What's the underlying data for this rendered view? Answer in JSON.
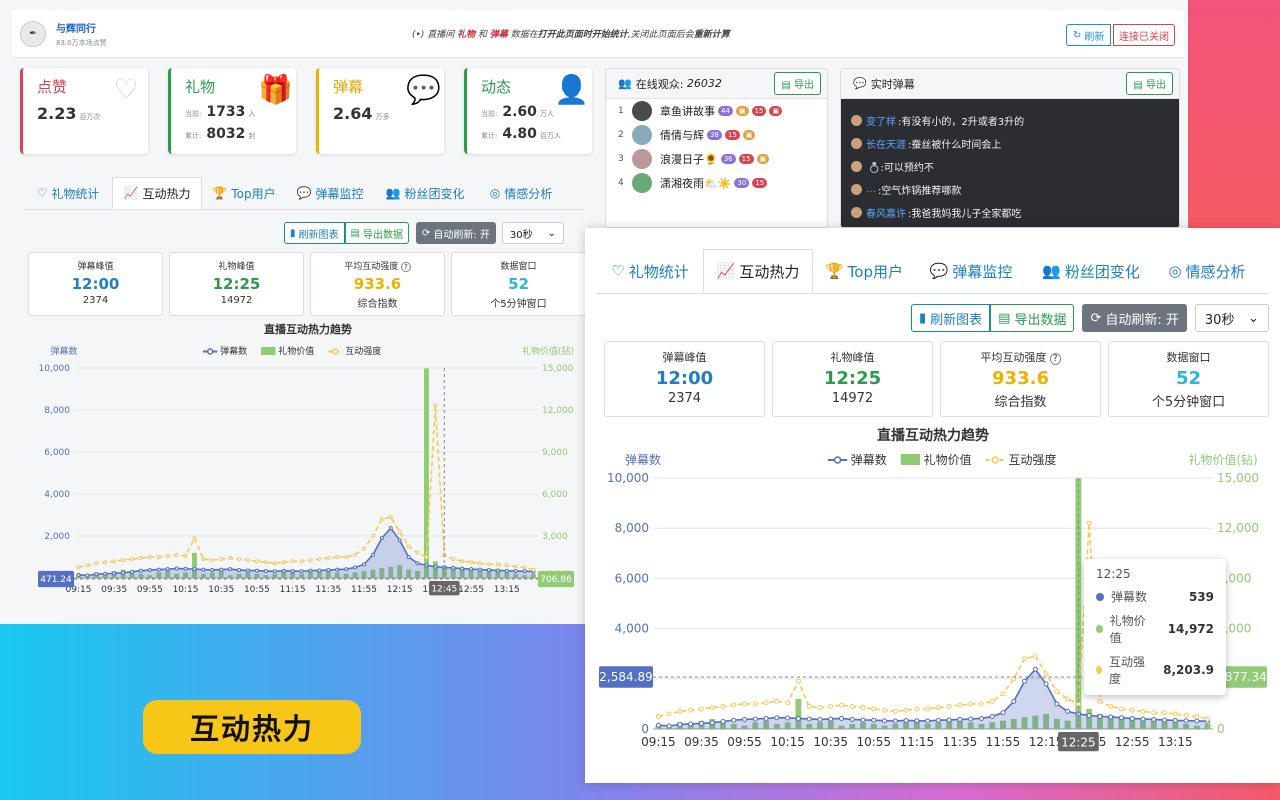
{
  "header": {
    "streamer_name": "与辉同行",
    "streamer_sub": "83.0万本场点赞",
    "notice_prefix": "直播间",
    "notice_gift": "礼物",
    "notice_and": "和",
    "notice_danmu": "弹幕",
    "notice_middle": "数据在",
    "notice_open": "打开此页面时开始统计",
    "notice_close": ",关闭此页面后会",
    "notice_recalc": "重新计算",
    "refresh_label": "刷新",
    "closed_label": "连接已关闭"
  },
  "stats": {
    "likes": {
      "title": "点赞",
      "value": "2.23",
      "unit": "百万次",
      "color": "#d9434f"
    },
    "gifts": {
      "title": "礼物",
      "current_label": "当前:",
      "current_value": "1733",
      "current_unit": "人",
      "total_label": "累计:",
      "total_value": "8032",
      "total_unit": "封",
      "color": "#2d9a4d"
    },
    "danmu": {
      "title": "弹幕",
      "value": "2.64",
      "unit": "万多",
      "color": "#e0a800"
    },
    "activity": {
      "title": "动态",
      "current_label": "当前:",
      "current_value": "2.60",
      "current_unit": "万人",
      "total_label": "累计:",
      "total_value": "4.80",
      "total_unit": "百万人",
      "color": "#2d9a4d"
    }
  },
  "viewers": {
    "title": "在线观众:",
    "count": "26032",
    "export_label": "导出",
    "items": [
      {
        "rank": "1",
        "name": "章鱼讲故事",
        "level": "44"
      },
      {
        "rank": "2",
        "name": "倩倩与辉",
        "level": "38"
      },
      {
        "rank": "3",
        "name": "浪漫日子🌻",
        "level": "36"
      },
      {
        "rank": "4",
        "name": "潇湘夜雨⛅☀️",
        "level": "30"
      }
    ]
  },
  "live_danmu": {
    "title": "实时弹幕",
    "export_label": "导出",
    "items": [
      {
        "user": "变了样",
        "text": ":有没有小的，2升或者3升的"
      },
      {
        "user": "长在天涯",
        "text": ":蚕丝被什么时间会上"
      },
      {
        "user": "",
        "text": "💍:可以预约不"
      },
      {
        "user": "…",
        "text": ":空气炸锅推荐哪款"
      },
      {
        "user": "春风嘉许",
        "text": ":我爸我妈我儿子全家都吃"
      }
    ]
  },
  "tabs": [
    {
      "label": "礼物统计",
      "icon": "heart-icon",
      "glyph": "♡"
    },
    {
      "label": "互动热力",
      "icon": "line-chart-icon",
      "glyph": "📈"
    },
    {
      "label": "Top用户",
      "icon": "trophy-icon",
      "glyph": "🏆"
    },
    {
      "label": "弹幕监控",
      "icon": "chat-icon",
      "glyph": "💬"
    },
    {
      "label": "粉丝团变化",
      "icon": "people-icon",
      "glyph": "👥"
    },
    {
      "label": "情感分析",
      "icon": "target-icon",
      "glyph": "◎"
    }
  ],
  "controls": {
    "refresh_chart": "刷新图表",
    "export_data": "导出数据",
    "auto_refresh": "自动刷新: 开",
    "interval": "30秒"
  },
  "kpis": [
    {
      "label": "弹幕峰值",
      "value": "12:00",
      "sub": "2374",
      "color": "#1d7fc7"
    },
    {
      "label": "礼物峰值",
      "value": "12:25",
      "sub": "14972",
      "color": "#2d9a4d"
    },
    {
      "label": "平均互动强度",
      "value": "933.6",
      "sub": "综合指数",
      "color": "#e8b400",
      "help": "?"
    },
    {
      "label": "数据窗口",
      "value": "52",
      "sub": "个5分钟窗口",
      "color": "#29b6d8"
    }
  ],
  "chart_data": {
    "type": "line",
    "title": "直播互动热力趋势",
    "y_left_label": "弹幕数",
    "y_right_label": "礼物价值(钻)",
    "legend": [
      "弹幕数",
      "礼物价值",
      "互动强度"
    ],
    "legend_position": "top-center",
    "ylim_left": [
      0,
      10000
    ],
    "ylim_right": [
      0,
      15000
    ],
    "y_left_ticks": [
      "0",
      "2,000",
      "4,000",
      "6,000",
      "8,000",
      "10,000"
    ],
    "y_right_ticks": [
      "0",
      "3,000",
      "6,000",
      "9,000",
      "12,000",
      "15,000"
    ],
    "x_ticks": [
      "09:15",
      "09:35",
      "09:55",
      "10:15",
      "10:35",
      "10:55",
      "11:15",
      "11:35",
      "11:55",
      "12:15",
      "12:35",
      "12:55",
      "13:15"
    ],
    "colors": {
      "danmu": "#5470c6",
      "gift": "#91cc75",
      "intensity": "#fac858"
    },
    "series": [
      {
        "name": "弹幕数",
        "values": [
          150,
          120,
          180,
          200,
          220,
          250,
          300,
          350,
          380,
          400,
          420,
          450,
          440,
          420,
          400,
          380,
          400,
          420,
          380,
          360,
          350,
          330,
          320,
          340,
          330,
          320,
          350,
          360,
          380,
          400,
          420,
          500,
          650,
          1100,
          1900,
          2374,
          1800,
          1000,
          700,
          600,
          539,
          500,
          480,
          450,
          420,
          400,
          380,
          360,
          340,
          330,
          320,
          310
        ]
      },
      {
        "name": "礼物价值",
        "values": [
          200,
          100,
          400,
          300,
          500,
          600,
          400,
          300,
          200,
          400,
          500,
          300,
          400,
          1800,
          300,
          400,
          500,
          200,
          300,
          400,
          300,
          200,
          300,
          400,
          500,
          300,
          400,
          500,
          600,
          400,
          300,
          400,
          500,
          600,
          700,
          800,
          900,
          600,
          500,
          14972,
          1200,
          900,
          800,
          700,
          600,
          500,
          600,
          500,
          400,
          300,
          200,
          300
        ]
      },
      {
        "name": "互动强度",
        "values": [
          500,
          600,
          700,
          750,
          800,
          850,
          900,
          950,
          1000,
          1000,
          1050,
          1100,
          1050,
          1900,
          900,
          850,
          900,
          950,
          900,
          850,
          800,
          750,
          700,
          750,
          800,
          800,
          850,
          900,
          950,
          1000,
          1000,
          1100,
          1400,
          2000,
          2800,
          2900,
          2200,
          1500,
          1200,
          1000,
          8203.9,
          1100,
          900,
          800,
          750,
          700,
          650,
          650,
          600,
          550,
          500,
          400
        ]
      }
    ],
    "crosshair_time": "12:25",
    "crosshair_label_front": "12:25",
    "crosshair_label_back": "12:45",
    "y_pointer_left_front": "2,584.89",
    "y_pointer_right_front": "3,877.34",
    "y_pointer_left_back": "471.24",
    "y_pointer_right_back": "706.86"
  },
  "tooltip": {
    "time": "12:25",
    "rows": [
      {
        "name": "弹幕数",
        "value": "539",
        "color": "#5470c6"
      },
      {
        "name": "礼物价值",
        "value": "14,972",
        "color": "#91cc75"
      },
      {
        "name": "互动强度",
        "value": "8,203.9",
        "color": "#fac858"
      }
    ]
  },
  "tag_label": "互动热力"
}
